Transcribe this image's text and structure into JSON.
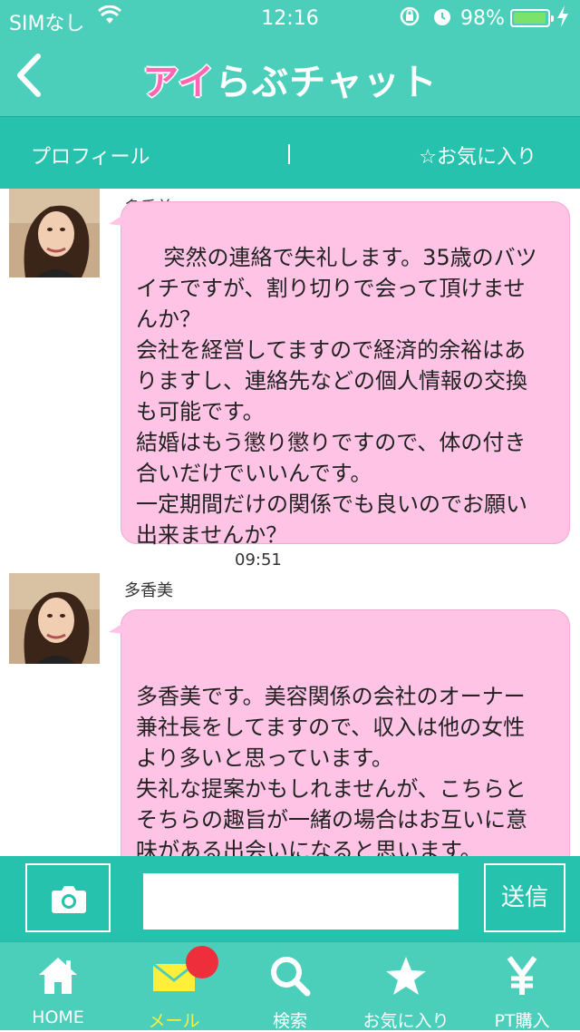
{
  "status_bar": {
    "carrier": "SIMなし",
    "time": "12:16",
    "battery_percent": "98%",
    "battery_level": 0.98,
    "icons": [
      "wifi-icon",
      "rotation-lock-icon",
      "alarm-icon",
      "battery-icon",
      "charging-bolt-icon"
    ]
  },
  "header": {
    "back_icon": "chevron-left-icon",
    "logo_part1": "アイ",
    "logo_part2": "らぶチャット"
  },
  "subnav": {
    "profile_label": "プロフィール",
    "favorite_label": "☆お気に入り"
  },
  "messages": [
    {
      "sender": "多香美",
      "text": "突然の連絡で失礼します。35歳のバツ\nイチですが、割り切りで会って頂けませ\nんか？\n会社を経営してますので経済的余裕はあ\nりますし、連絡先などの個人情報の交換\nも可能です。\n結婚はもう懲り懲りですので、体の付き\n合いだけでいいんです。\n一定期間だけの関係でも良いのでお願い\n出来ませんか？",
      "time": "09:51"
    },
    {
      "sender": "多香美",
      "text": "\n多香美です。美容関係の会社のオーナー\n兼社長をしてますので、収入は他の女性\nより多いと思っています。\n失礼な提案かもしれませんが、こちらと\nそちらの趣旨が一緒の場合はお互いに意\n味がある出会いになると思います。\n良かったら早々に会って頂けませんか？",
      "time": ""
    }
  ],
  "input_bar": {
    "camera_icon": "camera-icon",
    "message_value": "",
    "send_label": "送信"
  },
  "tab_bar": {
    "tabs": [
      {
        "label": "HOME",
        "icon": "home-icon",
        "active": false
      },
      {
        "label": "メール",
        "icon": "mail-icon",
        "active": true
      },
      {
        "label": "検索",
        "icon": "search-icon",
        "active": false
      },
      {
        "label": "お気に入り",
        "icon": "star-icon",
        "active": false
      },
      {
        "label": "PT購入",
        "icon": "yen-icon",
        "active": false
      }
    ],
    "mail_badge": "unread-badge"
  },
  "colors": {
    "teal": "#4bcfbb",
    "teal_dark": "#26c2ad",
    "bubble_pink": "#ffc4e5",
    "active_tab": "#ffef3a",
    "badge_red": "#ef2e3c"
  }
}
